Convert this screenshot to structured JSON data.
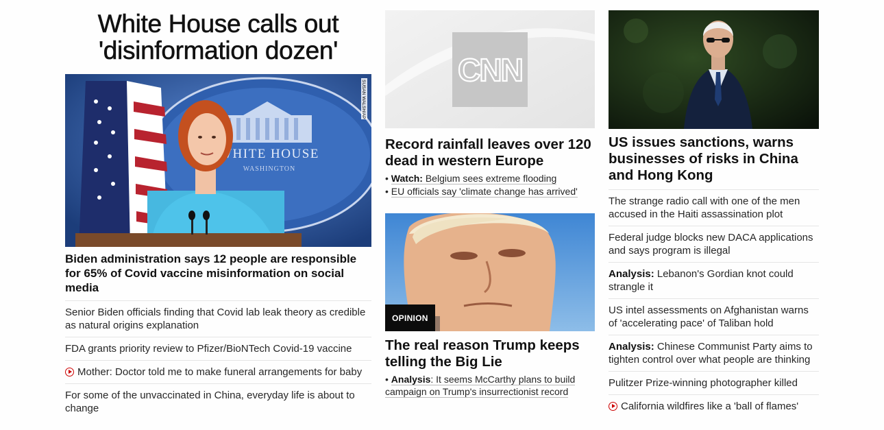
{
  "col1": {
    "banner": "White House calls out 'disinformation dozen'",
    "photo_credit": "SUSAN WALSH/AP",
    "podium_sign_line1": "WHITE HOUSE",
    "podium_sign_line2": "WASHINGTON",
    "lead_headline": "Biden administration says 12 people are responsible for 65% of Covid vaccine misinformation on social media",
    "items": [
      {
        "text": "Senior Biden officials finding that Covid lab leak theory as credible as natural origins explanation",
        "video": false
      },
      {
        "text": "FDA grants priority review to Pfizer/BioNTech Covid-19 vaccine",
        "video": false
      },
      {
        "text": "Mother: Doctor told me to make funeral arrangements for baby",
        "video": true
      },
      {
        "text": "For some of the unvaccinated in China, everyday life is about to change",
        "video": false
      }
    ]
  },
  "col2": {
    "card1": {
      "logo_text": "CNN",
      "headline": "Record rainfall leaves over 120 dead in western Europe",
      "sub_items": [
        {
          "kicker": "Watch:",
          "text": "Belgium sees extreme flooding"
        },
        {
          "kicker": "",
          "text": "EU officials say 'climate change has arrived'"
        }
      ]
    },
    "card2": {
      "badge": "OPINION",
      "headline": "The real reason Trump keeps telling the Big Lie",
      "sub_items": [
        {
          "kicker": "Analysis",
          "text": ": It seems McCarthy plans to build campaign on Trump's insurrectionist record"
        }
      ]
    }
  },
  "col3": {
    "headline": "US issues sanctions, warns businesses of risks in China and Hong Kong",
    "items": [
      {
        "kicker": "",
        "text": "The strange radio call with one of the men accused in the Haiti assassination plot",
        "video": false
      },
      {
        "kicker": "",
        "text": "Federal judge blocks new DACA applications and says program is illegal",
        "video": false
      },
      {
        "kicker": "Analysis:",
        "text": " Lebanon's Gordian knot could strangle it",
        "video": false
      },
      {
        "kicker": "",
        "text": "US intel assessments on Afghanistan warns of 'accelerating pace' of Taliban hold",
        "video": false
      },
      {
        "kicker": "Analysis:",
        "text": " Chinese Communist Party aims to tighten control over what people are thinking",
        "video": false
      },
      {
        "kicker": "",
        "text": "Pulitzer Prize-winning photographer killed",
        "video": false
      },
      {
        "kicker": "",
        "text": "California wildfires like a 'ball of flames'",
        "video": true
      }
    ]
  },
  "colors": {
    "accent_red": "#cc0000",
    "text": "#262626",
    "divider": "#e5e5e5"
  }
}
